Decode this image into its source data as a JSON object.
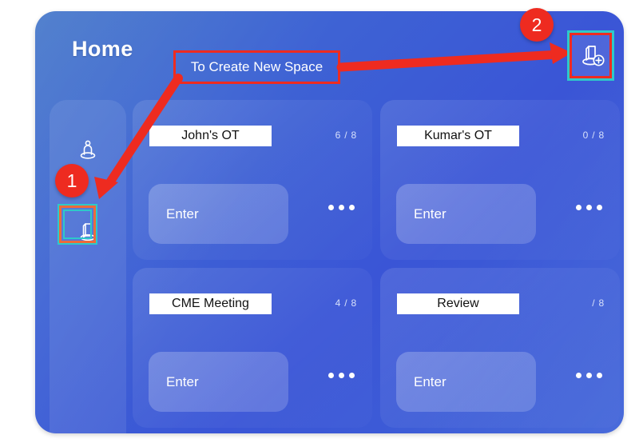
{
  "app": {
    "header_title": "Home",
    "panel_color": "#3d60d4",
    "accent_red": "#ee2b20",
    "accent_teal": "#2ec9c9"
  },
  "header": {
    "add_space_icon": "add-space-icon"
  },
  "sidebar": {
    "items": [
      {
        "name": "rail-item-person",
        "icon": "person-pedestal-icon",
        "selected": false
      },
      {
        "name": "rail-item-space",
        "icon": "space-pedestal-icon",
        "selected": true
      }
    ]
  },
  "cards": [
    {
      "title": "John's OT",
      "count": "6 / 8",
      "enter_label": "Enter",
      "more_icon": "more-dots-icon"
    },
    {
      "title": "Kumar's OT",
      "count": "0 / 8",
      "enter_label": "Enter",
      "more_icon": "more-dots-icon"
    },
    {
      "title": "CME Meeting",
      "count": "4 / 8",
      "enter_label": "Enter",
      "more_icon": "more-dots-icon"
    },
    {
      "title": "Review",
      "count": "/ 8",
      "enter_label": "Enter",
      "more_icon": "more-dots-icon"
    }
  ],
  "annotations": {
    "callout_label": "To Create New Space",
    "badges": [
      {
        "label": "1"
      },
      {
        "label": "2"
      }
    ]
  }
}
